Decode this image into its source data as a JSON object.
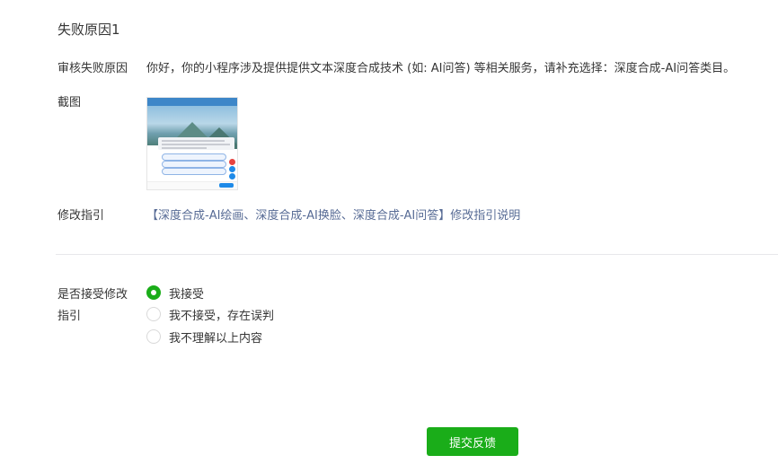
{
  "section": {
    "title": "失败原因1"
  },
  "reason": {
    "label": "审核失败原因",
    "text": "你好，你的小程序涉及提供提供文本深度合成技术 (如: AI问答) 等相关服务，请补充选择：深度合成-AI问答类目。"
  },
  "screenshot": {
    "label": "截图"
  },
  "guide": {
    "label": "修改指引",
    "link_text": "【深度合成-AI绘画、深度合成-AI换脸、深度合成-AI问答】修改指引说明"
  },
  "accept": {
    "label_line1": "是否接受修改",
    "label_line2": "指引",
    "options": [
      {
        "label": "我接受",
        "checked": true
      },
      {
        "label": "我不接受，存在误判",
        "checked": false
      },
      {
        "label": "我不理解以上内容",
        "checked": false
      }
    ]
  },
  "submit": {
    "label": "提交反馈"
  },
  "colors": {
    "accent": "#1aad19",
    "link": "#576b95",
    "divider": "#e7e7eb"
  }
}
